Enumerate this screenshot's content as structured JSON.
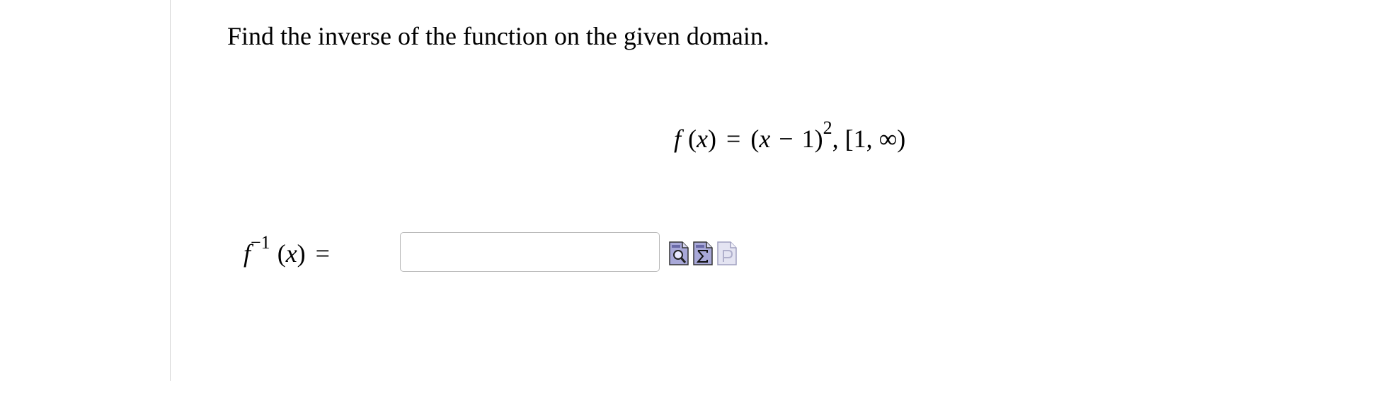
{
  "question": {
    "prompt": "Find the inverse of the function on the given domain.",
    "given": {
      "f": "f",
      "x": "x",
      "equals": "=",
      "one": "1",
      "exponent": "2",
      "domain_open": "[1,",
      "infinity": "∞",
      "domain_close": ")"
    },
    "answer": {
      "f": "f",
      "superscript": "−1",
      "x": "x",
      "equals": "=",
      "value": "",
      "placeholder": ""
    }
  },
  "toolbar": {
    "icons": [
      "preview-icon",
      "equation-editor-icon",
      "help-icon"
    ]
  }
}
